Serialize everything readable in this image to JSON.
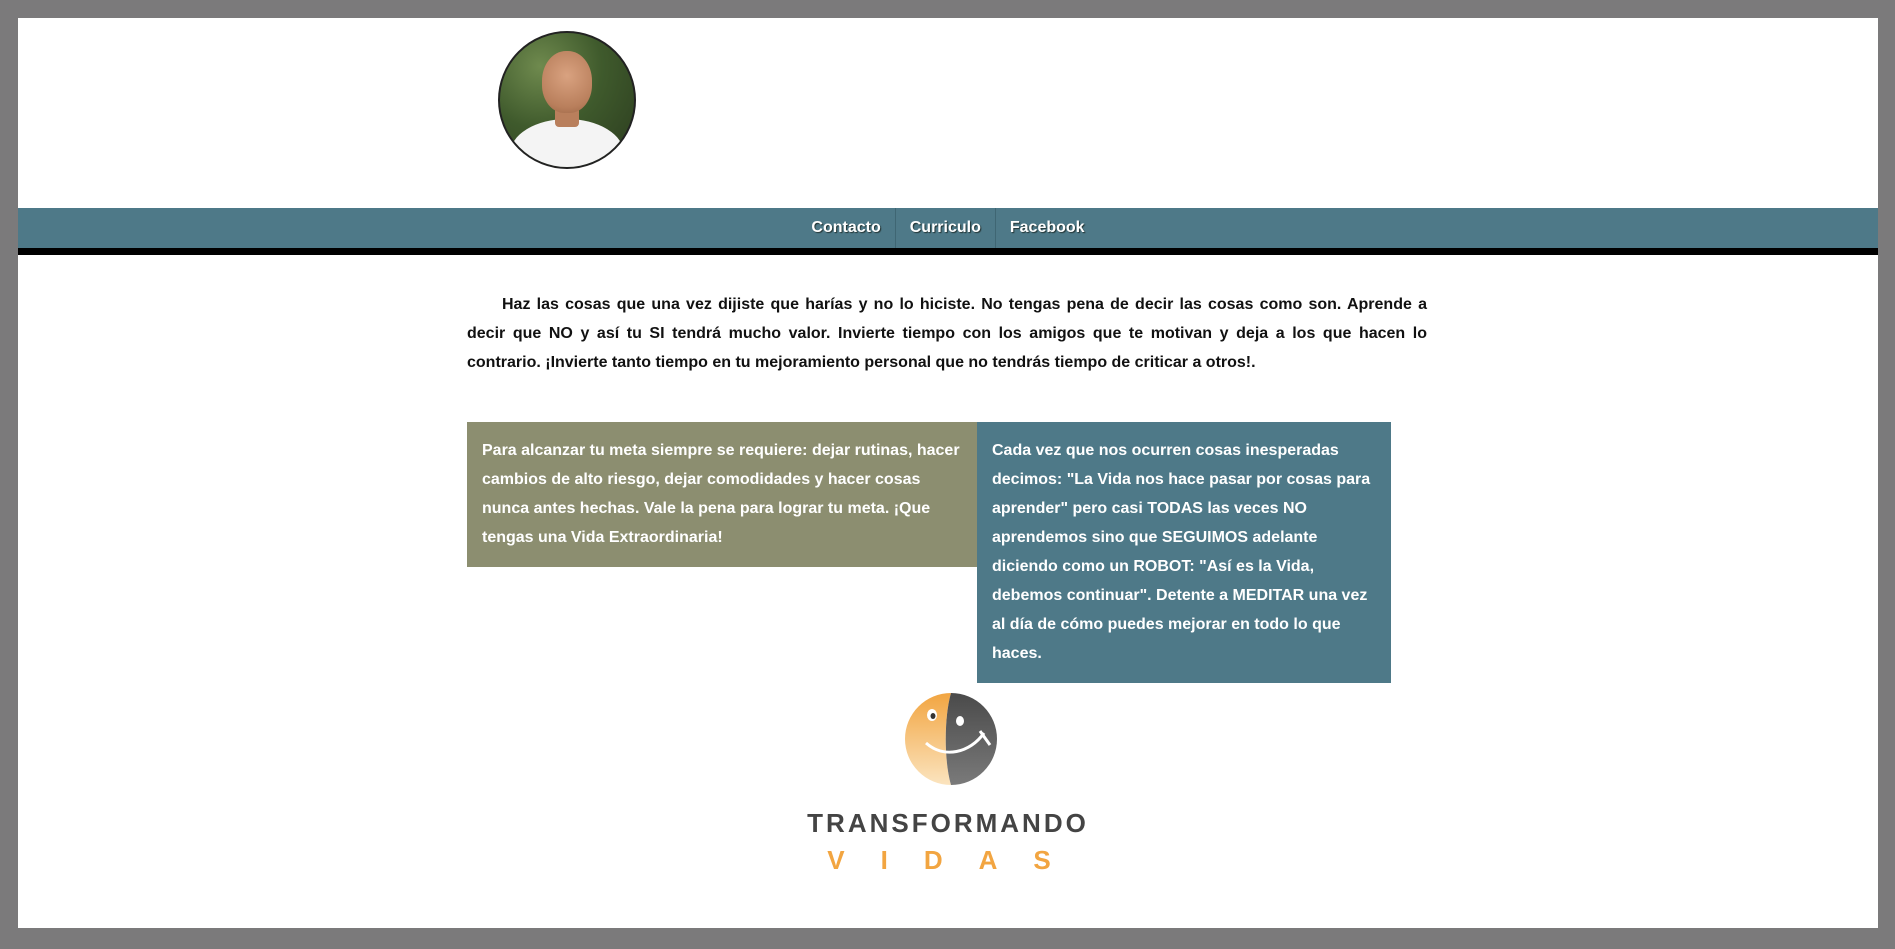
{
  "header": {
    "avatar_alt": "profile photo"
  },
  "nav": {
    "items": [
      {
        "label": "Contacto"
      },
      {
        "label": "Curriculo"
      },
      {
        "label": "Facebook"
      }
    ]
  },
  "intro": {
    "text": "Haz las cosas que una vez dijiste que harías y no lo hiciste. No tengas pena de decir las cosas como son. Aprende a decir que NO y así tu SI tendrá mucho valor. Invierte tiempo con los amigos que te motivan y deja a los que hacen lo contrario. ¡Invierte tanto tiempo en tu mejoramiento personal que no tendrás tiempo de criticar a otros!."
  },
  "boxes": {
    "left": "Para alcanzar tu meta siempre se requiere: dejar rutinas, hacer cambios de alto riesgo, dejar comodidades y hacer cosas nunca antes hechas. Vale la pena para lograr tu meta. ¡Que tengas una Vida Extraordinaria!",
    "right": "Cada vez que nos ocurren cosas inesperadas decimos: \"La Vida nos hace pasar por cosas para aprender\" pero casi TODAS las veces NO aprendemos sino que SEGUIMOS adelante diciendo como un ROBOT: \"Así es la Vida, debemos continuar\". Detente a MEDITAR una vez al día de cómo puedes mejorar en todo lo que haces."
  },
  "brand": {
    "line1": "TRANSFORMANDO",
    "line2": "VIDAS"
  },
  "colors": {
    "nav": "#4e7988",
    "box_left": "#8c8e70",
    "box_right": "#4e7988",
    "brand_orange": "#f2a541",
    "brand_gray": "#444444"
  }
}
